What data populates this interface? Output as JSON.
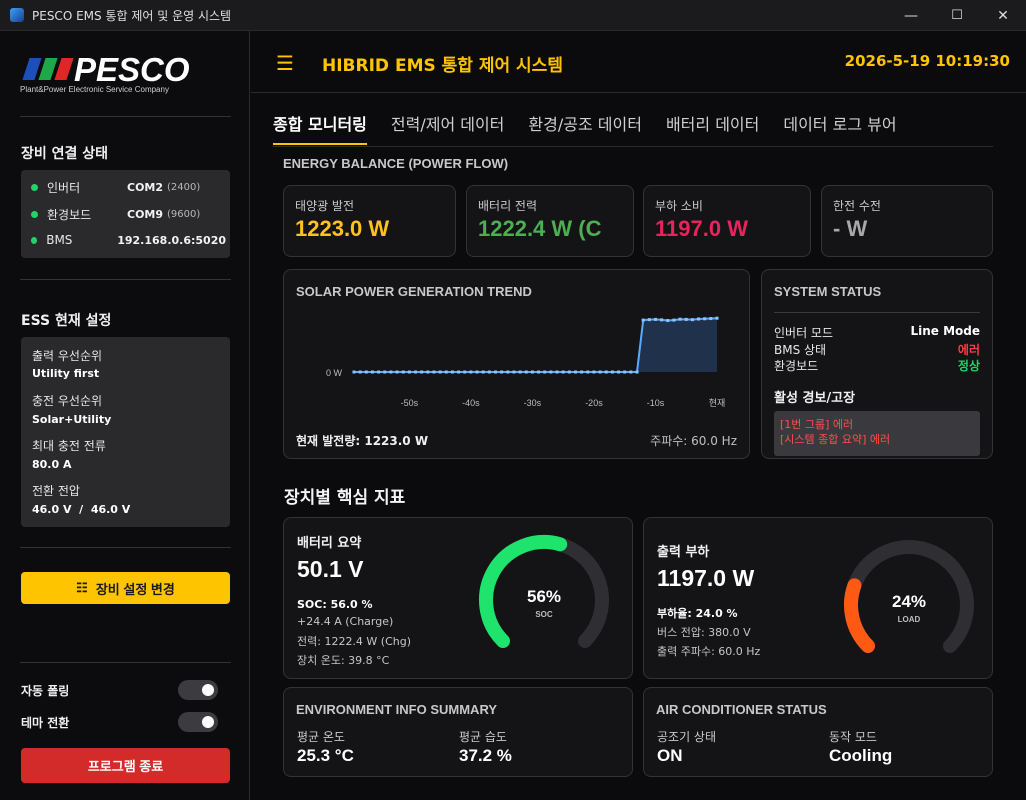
{
  "window": {
    "title": "PESCO EMS 통합 제어 및 운영 시스템",
    "minimize": "—",
    "maximize": "☐",
    "close": "✕"
  },
  "sidebar": {
    "logo_text": "PESCO",
    "logo_subtitle": "Plant&Power Electronic Service Company",
    "connection_heading": "장비 연결 상태",
    "connections": [
      {
        "name": "인버터",
        "port": "COM2",
        "baud": "(2400)"
      },
      {
        "name": "환경보드",
        "port": "COM9",
        "baud": "(9600)"
      },
      {
        "name": "BMS",
        "port": "192.168.0.6:5020",
        "baud": ""
      }
    ],
    "ess_heading": "ESS 현재 설정",
    "ess_settings": [
      {
        "label": "출력 우선순위",
        "value": "Utility first"
      },
      {
        "label": "충전 우선순위",
        "value": "Solar+Utility"
      },
      {
        "label": "최대 충전 전류",
        "value": "80.0 A"
      },
      {
        "label": "전환 전압",
        "value": "46.0 V  /  46.0 V"
      }
    ],
    "settings_button": "장비 설정 변경",
    "auto_polling_label": "자동 폴링",
    "theme_toggle_label": "테마 전환",
    "exit_button": "프로그램 종료"
  },
  "header": {
    "menu_icon": "☰",
    "title": "HIBRID EMS 통합 제어 시스템",
    "datetime": "2026-5-19 10:19:30"
  },
  "tabs": [
    {
      "label": "종합 모니터링",
      "active": true
    },
    {
      "label": "전력/제어 데이터",
      "active": false
    },
    {
      "label": "환경/공조 데이터",
      "active": false
    },
    {
      "label": "배터리 데이터",
      "active": false
    },
    {
      "label": "데이터 로그 뷰어",
      "active": false
    }
  ],
  "energy_balance": {
    "title": "ENERGY BALANCE (POWER FLOW)",
    "cards": [
      {
        "label": "태양광 발전",
        "value": "1223.0 W",
        "color": "#ffc11f"
      },
      {
        "label": "배터리 전력",
        "value": "1222.4 W (C",
        "color": "#4caf50"
      },
      {
        "label": "부하 소비",
        "value": "1197.0 W",
        "color": "#e8245c"
      },
      {
        "label": "한전 수전",
        "value": "- W",
        "color": "#a8a8a8"
      }
    ]
  },
  "solar_trend": {
    "title": "SOLAR POWER GENERATION TREND",
    "current_label": "현재 발전량: 1223.0 W",
    "frequency_label": "주파수: 60.0 Hz"
  },
  "chart_data": {
    "type": "area",
    "title": "SOLAR POWER GENERATION TREND",
    "xlabel": "",
    "ylabel": "",
    "x_ticks": [
      "-50s",
      "-40s",
      "-30s",
      "-20s",
      "-10s",
      "현재"
    ],
    "y_ticks": [
      "0 W"
    ],
    "x": [
      -59,
      -58,
      -57,
      -56,
      -55,
      -54,
      -53,
      -52,
      -51,
      -50,
      -49,
      -48,
      -47,
      -46,
      -45,
      -44,
      -43,
      -42,
      -41,
      -40,
      -39,
      -38,
      -37,
      -36,
      -35,
      -34,
      -33,
      -32,
      -31,
      -30,
      -29,
      -28,
      -27,
      -26,
      -25,
      -24,
      -23,
      -22,
      -21,
      -20,
      -19,
      -18,
      -17,
      -16,
      -15,
      -14,
      -13,
      -12,
      -11,
      -10,
      -9,
      -8,
      -7,
      -6,
      -5,
      -4,
      -3,
      -2,
      -1,
      0
    ],
    "values": [
      0,
      0,
      0,
      0,
      0,
      0,
      0,
      0,
      0,
      0,
      0,
      0,
      0,
      0,
      0,
      0,
      0,
      0,
      0,
      0,
      0,
      0,
      0,
      0,
      0,
      0,
      0,
      0,
      0,
      0,
      0,
      0,
      0,
      0,
      0,
      0,
      0,
      0,
      0,
      0,
      0,
      0,
      0,
      0,
      0,
      0,
      0,
      1180,
      1190,
      1195,
      1185,
      1170,
      1180,
      1200,
      1195,
      1190,
      1205,
      1210,
      1215,
      1223
    ],
    "color": "#5aa9ff",
    "grid": false
  },
  "system_status": {
    "title": "SYSTEM STATUS",
    "rows": [
      {
        "key": "인버터 모드",
        "value": "Line Mode",
        "color": "#ffffff"
      },
      {
        "key": "BMS 상태",
        "value": "에러",
        "color": "#ff3b3b"
      },
      {
        "key": "환경보드",
        "value": "정상",
        "color": "#22d36a"
      }
    ],
    "alarm_heading": "활성 경보/고장",
    "alarms": [
      "[1번 그룹] 에러",
      "[시스템 종합 요약] 에러"
    ]
  },
  "device_section_title": "장치별 핵심 지표",
  "battery": {
    "title": "배터리 요약",
    "value": "50.1 V",
    "lines": [
      "SOC: 56.0 %",
      "+24.4 A (Charge)",
      "전력: 1222.4 W (Chg)",
      "장치 온도: 39.8 °C"
    ],
    "gauge_percent": 56,
    "gauge_text": "56%",
    "gauge_label": "SOC",
    "gauge_color": "#1ee36d"
  },
  "load": {
    "title": "출력 부하",
    "value": "1197.0 W",
    "lines": [
      "부하율: 24.0 %",
      "버스 전압: 380.0 V",
      "출력 주파수: 60.0 Hz"
    ],
    "gauge_percent": 24,
    "gauge_text": "24%",
    "gauge_label": "LOAD",
    "gauge_color": "#ff5a14"
  },
  "environment": {
    "title": "ENVIRONMENT INFO SUMMARY",
    "temp_label": "평균 온도",
    "temp_value": "25.3 °C",
    "humidity_label": "평균 습도",
    "humidity_value": "37.2 %"
  },
  "aircon": {
    "title": "AIR CONDITIONER STATUS",
    "state_label": "공조기 상태",
    "state_value": "ON",
    "mode_label": "동작 모드",
    "mode_value": "Cooling"
  }
}
